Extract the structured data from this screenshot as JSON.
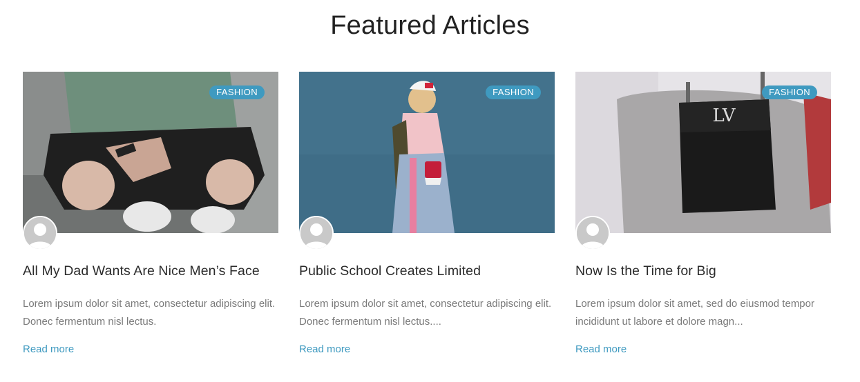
{
  "section": {
    "title": "Featured Articles"
  },
  "articles": [
    {
      "tag": "FASHION",
      "title": "All My Dad Wants Are Nice Men’s Face",
      "excerpt": "Lorem ipsum dolor sit amet, consectetur adipiscing elit. Donec fermentum nisl lectus.",
      "read_more": "Read more"
    },
    {
      "tag": "FASHION",
      "title": "Public School Creates Limited",
      "excerpt": "Lorem ipsum dolor sit amet, consectetur adipiscing elit. Donec fermentum nisl lectus....",
      "read_more": "Read more"
    },
    {
      "tag": "FASHION",
      "title": "Now Is the Time for Big",
      "excerpt": "Lorem ipsum dolor sit amet, sed do eiusmod tempor incididunt ut labore et dolore magn...",
      "read_more": "Read more"
    }
  ],
  "colors": {
    "accent": "#3f9ac0",
    "heading": "#222222",
    "body_text": "#7a7a7a"
  },
  "icons": {
    "avatar": "user-avatar-icon"
  }
}
